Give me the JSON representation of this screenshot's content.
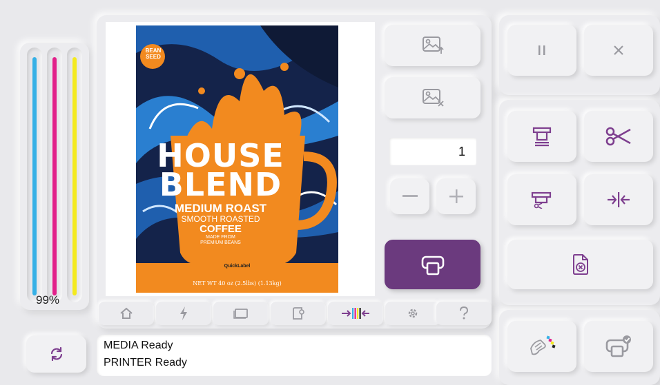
{
  "ink": {
    "level_label": "99%",
    "levels": {
      "cyan": 0.99,
      "magenta": 0.99,
      "yellow": 0.99
    },
    "colors": {
      "cyan": "#35b0e6",
      "magenta": "#e2208a",
      "yellow": "#f4ea1e"
    }
  },
  "label": {
    "brand_line1": "BEAN",
    "brand_line2": "SEED",
    "title_line1": "HOUSE",
    "title_line2": "BLEND",
    "roast": "MEDIUM ROAST",
    "smooth": "SMOOTH ROASTED",
    "coffee": "COFFEE",
    "made_from1": "MADE FROM",
    "made_from2": "PREMIUM BEANS",
    "maker": "QuickLabel",
    "net_weight": "NET WT 40 oz (2.5lbs) (1.13kg)"
  },
  "copies": {
    "value": "1"
  },
  "status": {
    "line1": "MEDIA Ready",
    "line2": "PRINTER Ready"
  },
  "theme": {
    "accent": "#6b3a7e",
    "icon": "#7e3f8f",
    "muted_icon": "#9a9aa0"
  }
}
